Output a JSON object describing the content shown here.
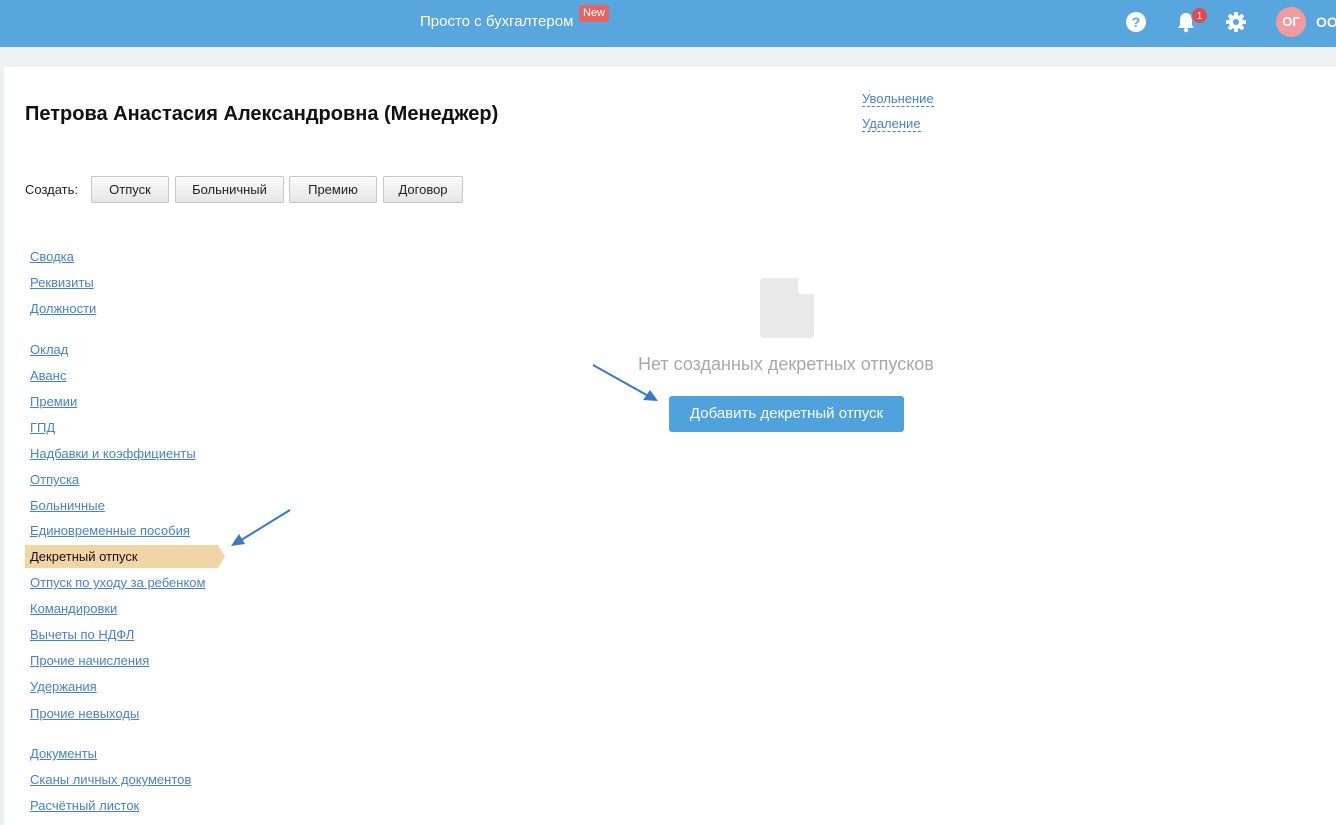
{
  "topbar": {
    "promo": "Просто с бухгалтером",
    "new_badge": "New",
    "notifications_count": "1",
    "avatar_initials": "ОГ",
    "org_name": "ОО",
    "colors": {
      "bar": "#58a6dd",
      "badge": "#e86464",
      "avatar": "#f19a9f"
    }
  },
  "employee": {
    "title": "Петрова Анастасия Александровна (Менеджер)"
  },
  "actions": {
    "dismissal": "Увольнение",
    "delete": "Удаление"
  },
  "create": {
    "label": "Создать:",
    "buttons": [
      "Отпуск",
      "Больничный",
      "Премию",
      "Договор"
    ]
  },
  "nav": {
    "items": [
      "Сводка",
      "Реквизиты",
      "Должности",
      "Оклад",
      "Аванс",
      "Премии",
      "ГПД",
      "Надбавки и коэффициенты",
      "Отпуска",
      "Больничные",
      "Единовременные пособия",
      "Декретный отпуск",
      "Отпуск по уходу за ребенком",
      "Командировки",
      "Вычеты по НДФЛ",
      "Прочие начисления",
      "Удержания",
      "Прочие невыходы",
      "Документы",
      "Сканы личных документов",
      "Расчётный листок"
    ],
    "active": "Декретный отпуск"
  },
  "empty_state": {
    "icon": "document-icon",
    "text": "Нет созданных декретных отпусков",
    "button": "Добавить декретный отпуск"
  }
}
